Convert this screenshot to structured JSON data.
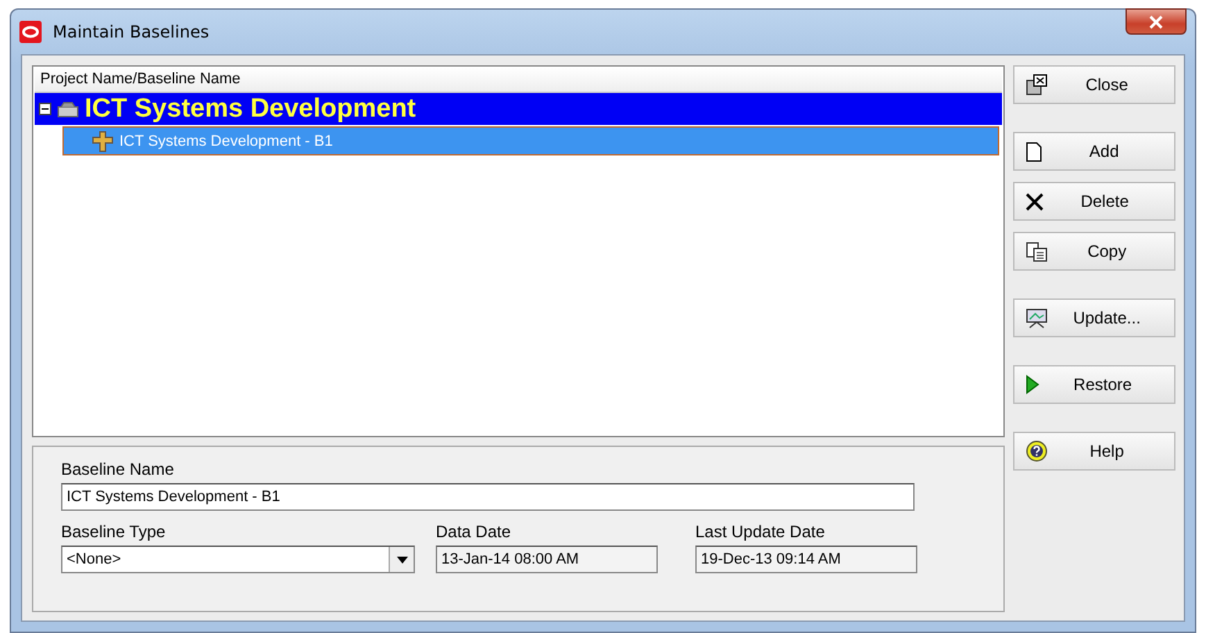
{
  "window": {
    "title": "Maintain Baselines"
  },
  "tree": {
    "column": "Project Name/Baseline Name",
    "items": [
      {
        "label": "ICT Systems Development",
        "kind": "project",
        "expanded": true,
        "selected": false,
        "children": [
          {
            "label": "ICT Systems Development - B1",
            "kind": "baseline",
            "selected": true
          }
        ]
      }
    ]
  },
  "details": {
    "baseline_name": {
      "label": "Baseline Name",
      "value": "ICT Systems Development - B1"
    },
    "baseline_type": {
      "label": "Baseline Type",
      "value": "<None>"
    },
    "data_date": {
      "label": "Data Date",
      "value": "13-Jan-14 08:00 AM"
    },
    "last_update_date": {
      "label": "Last Update Date",
      "value": "19-Dec-13 09:14 AM"
    }
  },
  "button_groups": [
    [
      {
        "label": "Close",
        "kind": "close"
      }
    ],
    [
      {
        "label": "Add",
        "kind": "add"
      },
      {
        "label": "Delete",
        "kind": "delete"
      },
      {
        "label": "Copy",
        "kind": "copy"
      }
    ],
    [
      {
        "label": "Update...",
        "kind": "update"
      }
    ],
    [
      {
        "label": "Restore",
        "kind": "restore"
      }
    ],
    [
      {
        "label": "Help",
        "kind": "help"
      }
    ]
  ]
}
